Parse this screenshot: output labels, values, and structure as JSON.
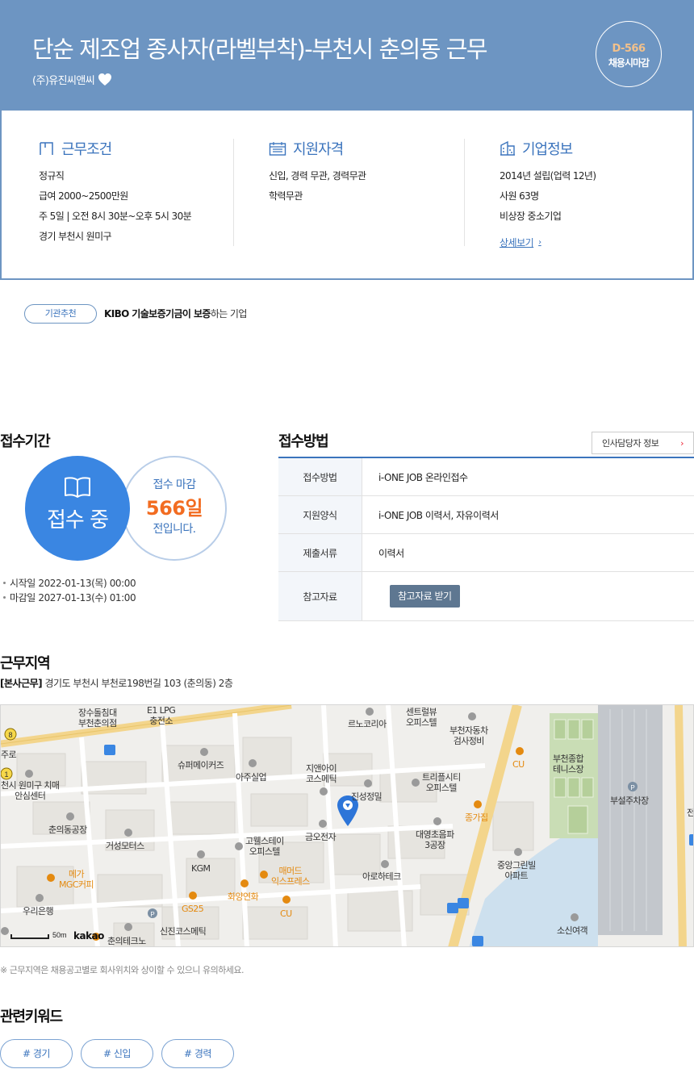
{
  "header": {
    "title": "단순 제조업 종사자(라벨부착)-부천시 춘의동 근무",
    "company": "(주)유진씨앤씨",
    "dday": "D-566",
    "dday_label": "채용시마감"
  },
  "info": {
    "work": {
      "title": "근무조건",
      "lines": [
        "정규직",
        "급여 2000~2500만원",
        "주 5일 | 오전 8시 30분~오후 5시 30분",
        "경기 부천시 원미구"
      ]
    },
    "qualification": {
      "title": "지원자격",
      "lines": [
        "신입, 경력 무관, 경력무관",
        "학력무관"
      ]
    },
    "company": {
      "title": "기업정보",
      "lines": [
        "2014년 설립(업력 12년)",
        "사원 63명",
        "비상장 중소기업"
      ],
      "link": "상세보기"
    }
  },
  "recommendation": {
    "badge": "기관추천",
    "bold": "KIBO 기술보증기금이 보증",
    "rest": "하는 기업"
  },
  "period": {
    "title": "접수기간",
    "status": "접수 중",
    "deadline_top": "접수 마감",
    "deadline_days": "566일",
    "deadline_bottom": "전입니다.",
    "start": "시작일 2022-01-13(목) 00:00",
    "end": "마감일 2027-01-13(수) 01:00"
  },
  "method": {
    "title": "접수방법",
    "hr_button": "인사담당자 정보",
    "rows": [
      {
        "label": "접수방법",
        "value": "i-ONE JOB 온라인접수"
      },
      {
        "label": "지원양식",
        "value": "i-ONE JOB 이력서, 자유이력서"
      },
      {
        "label": "제출서류",
        "value": "이력서"
      },
      {
        "label": "참고자료",
        "button": "참고자료 받기"
      }
    ]
  },
  "location": {
    "title": "근무지역",
    "tag": "[본사근무]",
    "address": "경기도 부천시 부천로198번길 103 (춘의동) 2층",
    "notice": "※ 근무지역은 채용공고별로 회사위치와 상이할 수 있으니 유의하세요.",
    "scale": "50m",
    "brand": "kakao",
    "labels": {
      "l1": "장수돌침대\n부천춘의점",
      "l2": "E1 LPG\n충전소",
      "l3": "르노코리아",
      "l4": "센트럴뷰\n오피스텔",
      "l5": "부천자동차\n검사정비",
      "l6": "CU",
      "l7": "부천종합\n테니스장",
      "l8": "부설주차장",
      "l9": "천시 원미구 치매\n안심센터",
      "l10": "슈퍼메이커즈",
      "l11": "아주실업",
      "l12": "지앤아이\n코스메틱",
      "l13": "진성정밀",
      "l14": "트리플시티\n오피스텔",
      "l15": "종가집",
      "l16": "춘의동공장",
      "l17": "거성모터스",
      "l18": "고웰스테이\n오피스텔",
      "l19": "금오전자",
      "l20": "대영초음파\n3공장",
      "l21": "중앙그린빌\n아파트",
      "l22": "KGM",
      "l23": "메가\nMGC커피",
      "l24": "매머드\n익스프레스",
      "l25": "아로하테크",
      "l26": "화양연화",
      "l27": "GS25",
      "l28": "CU",
      "l29": "우리은행",
      "l30": "신진코스메틱",
      "l31": "춘의테크노",
      "l32": "소신여객",
      "l33": "주로",
      "l34": "전"
    }
  },
  "keywords": {
    "title": "관련키워드",
    "items": [
      "# 경기",
      "# 신입",
      "# 경력"
    ]
  }
}
